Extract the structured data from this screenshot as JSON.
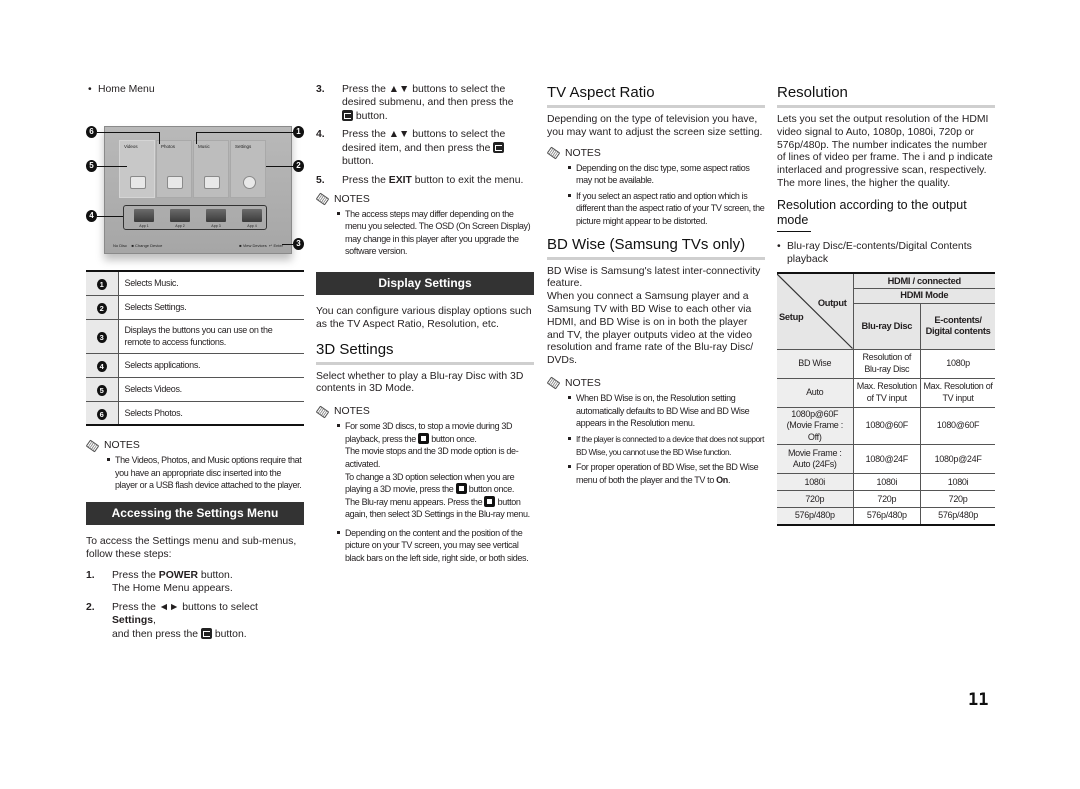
{
  "page_number": "11",
  "col1": {
    "home_menu_bullet": "Home Menu",
    "figure": {
      "tiles": [
        "Videos",
        "Photos",
        "Music",
        "Settings"
      ],
      "apps": [
        "App 1",
        "App 2",
        "App 3",
        "App 4"
      ],
      "footer_left": "No Disc",
      "footer_change": "Change Device",
      "footer_view": "View Devices",
      "footer_enter": "Enter",
      "callouts": [
        "1",
        "2",
        "3",
        "4",
        "5",
        "6"
      ]
    },
    "legend": [
      {
        "num": "1",
        "text": "Selects Music."
      },
      {
        "num": "2",
        "text": "Selects Settings."
      },
      {
        "num": "3",
        "text": "Displays the buttons you can use on the remote to access functions."
      },
      {
        "num": "4",
        "text": "Selects applications."
      },
      {
        "num": "5",
        "text": "Selects Videos."
      },
      {
        "num": "6",
        "text": "Selects Photos."
      }
    ],
    "notes_title": "NOTES",
    "notes": [
      "The Videos, Photos, and Music options require that you have an appropriate disc inserted into the player or a USB flash device attached to the player."
    ],
    "section_band": "Accessing the Settings Menu",
    "intro": "To access the Settings menu and sub-menus, follow these steps:",
    "steps": [
      {
        "n": "1.",
        "a": "Press the ",
        "b": "POWER",
        "c": " button.",
        "d": "The Home Menu appears."
      },
      {
        "n": "2.",
        "a": "Press the ◄► buttons to select ",
        "b": "Settings",
        "c": ",",
        "d": "and then press the",
        "e": " button."
      }
    ]
  },
  "col2": {
    "steps": [
      {
        "n": "3.",
        "a": "Press the ▲▼ buttons to select the desired submenu, and then press the",
        "e": " button."
      },
      {
        "n": "4.",
        "a": "Press the ▲▼ buttons to select the desired item, and then press the",
        "e": " button."
      },
      {
        "n": "5.",
        "a": "Press the ",
        "b": "EXIT",
        "c": " button to exit the menu."
      }
    ],
    "notes_title": "NOTES",
    "notes": [
      "The access steps may differ depending on the menu you selected. The OSD (On Screen Display) may change in this player after you upgrade the software version."
    ],
    "section_band": "Display Settings",
    "display_intro": "You can configure various display options such as the TV Aspect Ratio, Resolution, etc.",
    "h_3d": "3D Settings",
    "intro_3d": "Select whether to play a Blu-ray Disc with 3D contents in 3D Mode.",
    "notes2_title": "NOTES",
    "note3d_1": {
      "p1a": "For some 3D discs, to stop a movie during 3D playback, press the",
      "p1b": " button once.",
      "p2": "The movie stops and the 3D mode option is de-activated.",
      "p3a": "To change a 3D option selection when you are playing a 3D movie, press the",
      "p3b": " button once.",
      "p4a": "The Blu-ray menu appears. Press the",
      "p4b": " button again, then select 3D Settings in the Blu-ray menu."
    },
    "note3d_2": "Depending on the content and the position of the picture on your TV screen, you may see vertical black bars on the left side, right side, or both sides."
  },
  "col3": {
    "h_aspect": "TV Aspect Ratio",
    "aspect_intro": "Depending on the type of television you have, you may want to adjust the screen size setting.",
    "notes_title": "NOTES",
    "aspect_notes": [
      "Depending on the disc type, some aspect ratios may not be available.",
      "If you select an aspect ratio and option which is different than the aspect ratio of your TV screen, the picture might appear to be distorted."
    ],
    "h_bdwise": "BD Wise (Samsung TVs only)",
    "bdwise_p1": "BD Wise is Samsung's latest inter-connectivity feature.",
    "bdwise_p2": "When you connect a Samsung player and a Samsung TV with BD Wise to each other via HDMI, and BD Wise is on in both the player and TV, the player outputs video at the video resolution and frame rate of the Blu-ray Disc/ DVDs.",
    "notes2_title": "NOTES",
    "bdwise_notes": [
      "When BD Wise is on, the Resolution setting automatically defaults to BD Wise and BD Wise appears in the Resolution menu.",
      "If the player is connected to a device that does not support BD Wise, you cannot use the BD Wise function."
    ],
    "bdwise_note3_a": "For proper operation of BD Wise, set the BD Wise menu of both the player and the TV to ",
    "bdwise_note3_b": "On",
    "bdwise_note3_c": "."
  },
  "col4": {
    "h_resolution": "Resolution",
    "res_intro": "Lets you set the output resolution of the HDMI video signal to Auto, 1080p, 1080i, 720p or 576p/480p. The number indicates the number of lines of video per frame. The i and p indicate interlaced and progressive scan, respectively. The more lines, the higher the quality.",
    "h_res_mode": "Resolution according to the output mode",
    "bullet": "Blu-ray Disc/E-contents/Digital Contents playback",
    "table": {
      "corner_output": "Output",
      "corner_setup": "Setup",
      "hdr1": "HDMI / connected",
      "hdr2": "HDMI Mode",
      "col_a": "Blu-ray Disc",
      "col_b": "E-contents/ Digital contents",
      "rows": [
        {
          "setup": "BD Wise",
          "a": "Resolution of Blu-ray Disc",
          "b": "1080p"
        },
        {
          "setup": "Auto",
          "a": "Max. Resolution of TV input",
          "b": "Max. Resolution of TV input"
        },
        {
          "setup": "1080p@60F (Movie Frame : Off)",
          "a": "1080@60F",
          "b": "1080@60F"
        },
        {
          "setup": "Movie Frame : Auto (24Fs)",
          "a": "1080@24F",
          "b": "1080p@24F"
        },
        {
          "setup": "1080i",
          "a": "1080i",
          "b": "1080i"
        },
        {
          "setup": "720p",
          "a": "720p",
          "b": "720p"
        },
        {
          "setup": "576p/480p",
          "a": "576p/480p",
          "b": "576p/480p"
        }
      ]
    }
  }
}
